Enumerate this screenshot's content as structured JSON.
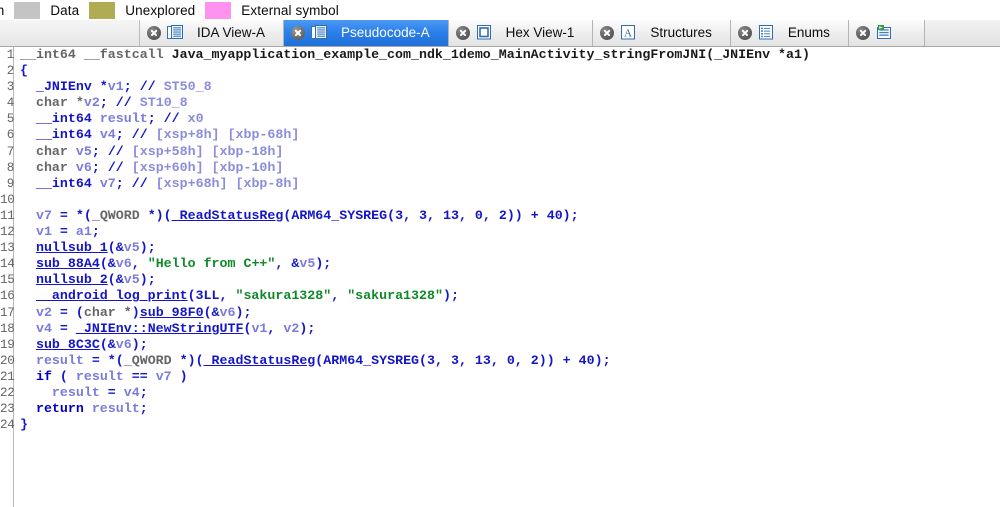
{
  "legend": {
    "items": [
      {
        "label": "ion",
        "swatch": null,
        "truncated": true
      },
      {
        "label": "Data",
        "swatch": "#c4c4c4"
      },
      {
        "label": "Unexplored",
        "swatch": "#b0ac54"
      },
      {
        "label": "External symbol",
        "swatch": "#ff92ef"
      }
    ]
  },
  "tabs": [
    {
      "label": "IDA View-A",
      "icon": "document-list-icon",
      "active": false,
      "closable": true
    },
    {
      "label": "Pseudocode-A",
      "icon": "document-list-icon",
      "active": true,
      "closable": true
    },
    {
      "label": "Hex View-1",
      "icon": "hex-square-icon",
      "active": false,
      "closable": true
    },
    {
      "label": "Structures",
      "icon": "letter-a-icon",
      "active": false,
      "closable": true
    },
    {
      "label": "Enums",
      "icon": "enum-list-icon",
      "active": false,
      "closable": true
    },
    {
      "label": "",
      "icon": "imports-icon",
      "active": false,
      "closable": true
    }
  ],
  "colors": {
    "active_tab": "#2b7fe8",
    "string": "#0f8a2a",
    "comment": "#8c8cdc",
    "variable": "#7b7bdc",
    "function": "#1414c8",
    "type": "#666666",
    "line_number": "#646464"
  },
  "code": {
    "language": "pseudocode-c",
    "first_line_number": 1,
    "lines": [
      {
        "n": "1",
        "tokens": [
          {
            "t": "type",
            "v": "__int64 __fastcall "
          },
          {
            "t": "plain",
            "v": "Java_myapplication_example_com_ndk_1demo_MainActivity_stringFromJNI(_JNIEnv *a1)"
          }
        ]
      },
      {
        "n": "2",
        "tokens": [
          {
            "t": "fn",
            "v": "{"
          }
        ]
      },
      {
        "n": "3",
        "tokens": [
          {
            "t": "plain",
            "v": "  "
          },
          {
            "t": "fn",
            "v": "_JNIEnv *"
          },
          {
            "t": "var",
            "v": "v1"
          },
          {
            "t": "fn",
            "v": "; "
          },
          {
            "t": "fn",
            "v": "// "
          },
          {
            "t": "cmt",
            "v": "ST50_8"
          }
        ]
      },
      {
        "n": "4",
        "tokens": [
          {
            "t": "plain",
            "v": "  "
          },
          {
            "t": "type",
            "v": "char *"
          },
          {
            "t": "var",
            "v": "v2"
          },
          {
            "t": "fn",
            "v": "; "
          },
          {
            "t": "fn",
            "v": "// "
          },
          {
            "t": "cmt",
            "v": "ST10_8"
          }
        ]
      },
      {
        "n": "5",
        "tokens": [
          {
            "t": "plain",
            "v": "  "
          },
          {
            "t": "fn",
            "v": "__int64 "
          },
          {
            "t": "var",
            "v": "result"
          },
          {
            "t": "fn",
            "v": "; "
          },
          {
            "t": "fn",
            "v": "// "
          },
          {
            "t": "cmt",
            "v": "x0"
          }
        ]
      },
      {
        "n": "6",
        "tokens": [
          {
            "t": "plain",
            "v": "  "
          },
          {
            "t": "fn",
            "v": "__int64 "
          },
          {
            "t": "var",
            "v": "v4"
          },
          {
            "t": "fn",
            "v": "; "
          },
          {
            "t": "fn",
            "v": "// "
          },
          {
            "t": "cmt",
            "v": "[xsp+8h] [xbp-68h]"
          }
        ]
      },
      {
        "n": "7",
        "tokens": [
          {
            "t": "plain",
            "v": "  "
          },
          {
            "t": "type",
            "v": "char "
          },
          {
            "t": "var",
            "v": "v5"
          },
          {
            "t": "fn",
            "v": "; "
          },
          {
            "t": "fn",
            "v": "// "
          },
          {
            "t": "cmt",
            "v": "[xsp+58h] [xbp-18h]"
          }
        ]
      },
      {
        "n": "8",
        "tokens": [
          {
            "t": "plain",
            "v": "  "
          },
          {
            "t": "type",
            "v": "char "
          },
          {
            "t": "var",
            "v": "v6"
          },
          {
            "t": "fn",
            "v": "; "
          },
          {
            "t": "fn",
            "v": "// "
          },
          {
            "t": "cmt",
            "v": "[xsp+60h] [xbp-10h]"
          }
        ]
      },
      {
        "n": "9",
        "tokens": [
          {
            "t": "plain",
            "v": "  "
          },
          {
            "t": "fn",
            "v": "__int64 "
          },
          {
            "t": "var",
            "v": "v7"
          },
          {
            "t": "fn",
            "v": "; "
          },
          {
            "t": "fn",
            "v": "// "
          },
          {
            "t": "cmt",
            "v": "[xsp+68h] [xbp-8h]"
          }
        ]
      },
      {
        "n": "10",
        "tokens": []
      },
      {
        "n": "11",
        "tokens": [
          {
            "t": "plain",
            "v": "  "
          },
          {
            "t": "var",
            "v": "v7"
          },
          {
            "t": "fn",
            "v": " = *("
          },
          {
            "t": "type",
            "v": "_QWORD "
          },
          {
            "t": "fn",
            "v": "*)("
          },
          {
            "t": "fnlink",
            "v": "_ReadStatusReg"
          },
          {
            "t": "fn",
            "v": "("
          },
          {
            "t": "fn",
            "v": "ARM64_SYSREG"
          },
          {
            "t": "fn",
            "v": "(3, 3, 13, 0, 2)) + 40);"
          }
        ]
      },
      {
        "n": "12",
        "tokens": [
          {
            "t": "plain",
            "v": "  "
          },
          {
            "t": "var",
            "v": "v1"
          },
          {
            "t": "fn",
            "v": " = "
          },
          {
            "t": "var",
            "v": "a1"
          },
          {
            "t": "fn",
            "v": ";"
          }
        ]
      },
      {
        "n": "13",
        "tokens": [
          {
            "t": "plain",
            "v": "  "
          },
          {
            "t": "fnlink",
            "v": "nullsub_1"
          },
          {
            "t": "fn",
            "v": "(&"
          },
          {
            "t": "var",
            "v": "v5"
          },
          {
            "t": "fn",
            "v": ");"
          }
        ]
      },
      {
        "n": "14",
        "tokens": [
          {
            "t": "plain",
            "v": "  "
          },
          {
            "t": "fnlink",
            "v": "sub_88A4"
          },
          {
            "t": "fn",
            "v": "(&"
          },
          {
            "t": "var",
            "v": "v6"
          },
          {
            "t": "fn",
            "v": ", "
          },
          {
            "t": "str",
            "v": "\"Hello from C++\""
          },
          {
            "t": "fn",
            "v": ", &"
          },
          {
            "t": "var",
            "v": "v5"
          },
          {
            "t": "fn",
            "v": ");"
          }
        ]
      },
      {
        "n": "15",
        "tokens": [
          {
            "t": "plain",
            "v": "  "
          },
          {
            "t": "fnlink",
            "v": "nullsub_2"
          },
          {
            "t": "fn",
            "v": "(&"
          },
          {
            "t": "var",
            "v": "v5"
          },
          {
            "t": "fn",
            "v": ");"
          }
        ]
      },
      {
        "n": "16",
        "tokens": [
          {
            "t": "plain",
            "v": "  "
          },
          {
            "t": "fnlink",
            "v": "__android_log_print"
          },
          {
            "t": "fn",
            "v": "(3LL, "
          },
          {
            "t": "str",
            "v": "\"sakura1328\""
          },
          {
            "t": "fn",
            "v": ", "
          },
          {
            "t": "str",
            "v": "\"sakura1328\""
          },
          {
            "t": "fn",
            "v": ");"
          }
        ]
      },
      {
        "n": "17",
        "tokens": [
          {
            "t": "plain",
            "v": "  "
          },
          {
            "t": "var",
            "v": "v2"
          },
          {
            "t": "fn",
            "v": " = ("
          },
          {
            "t": "type",
            "v": "char *"
          },
          {
            "t": "fn",
            "v": ")"
          },
          {
            "t": "fnlink",
            "v": "sub_98F0"
          },
          {
            "t": "fn",
            "v": "(&"
          },
          {
            "t": "var",
            "v": "v6"
          },
          {
            "t": "fn",
            "v": ");"
          }
        ]
      },
      {
        "n": "18",
        "tokens": [
          {
            "t": "plain",
            "v": "  "
          },
          {
            "t": "var",
            "v": "v4"
          },
          {
            "t": "fn",
            "v": " = "
          },
          {
            "t": "fnlink",
            "v": "_JNIEnv::NewStringUTF"
          },
          {
            "t": "fn",
            "v": "("
          },
          {
            "t": "var",
            "v": "v1"
          },
          {
            "t": "fn",
            "v": ", "
          },
          {
            "t": "var",
            "v": "v2"
          },
          {
            "t": "fn",
            "v": ");"
          }
        ]
      },
      {
        "n": "19",
        "tokens": [
          {
            "t": "plain",
            "v": "  "
          },
          {
            "t": "fnlink",
            "v": "sub_8C3C"
          },
          {
            "t": "fn",
            "v": "(&"
          },
          {
            "t": "var",
            "v": "v6"
          },
          {
            "t": "fn",
            "v": ");"
          }
        ]
      },
      {
        "n": "20",
        "tokens": [
          {
            "t": "plain",
            "v": "  "
          },
          {
            "t": "var",
            "v": "result"
          },
          {
            "t": "fn",
            "v": " = *("
          },
          {
            "t": "type",
            "v": "_QWORD "
          },
          {
            "t": "fn",
            "v": "*)("
          },
          {
            "t": "fnlink",
            "v": "_ReadStatusReg"
          },
          {
            "t": "fn",
            "v": "("
          },
          {
            "t": "fn",
            "v": "ARM64_SYSREG"
          },
          {
            "t": "fn",
            "v": "(3, 3, 13, 0, 2)) + 40);"
          }
        ]
      },
      {
        "n": "21",
        "tokens": [
          {
            "t": "plain",
            "v": "  "
          },
          {
            "t": "kw",
            "v": "if"
          },
          {
            "t": "fn",
            "v": " ( "
          },
          {
            "t": "var",
            "v": "result"
          },
          {
            "t": "fn",
            "v": " == "
          },
          {
            "t": "var",
            "v": "v7"
          },
          {
            "t": "fn",
            "v": " )"
          }
        ]
      },
      {
        "n": "22",
        "tokens": [
          {
            "t": "plain",
            "v": "    "
          },
          {
            "t": "var",
            "v": "result"
          },
          {
            "t": "fn",
            "v": " = "
          },
          {
            "t": "var",
            "v": "v4"
          },
          {
            "t": "fn",
            "v": ";"
          }
        ]
      },
      {
        "n": "23",
        "tokens": [
          {
            "t": "plain",
            "v": "  "
          },
          {
            "t": "kw",
            "v": "return "
          },
          {
            "t": "var",
            "v": "result"
          },
          {
            "t": "fn",
            "v": ";"
          }
        ]
      },
      {
        "n": "24",
        "tokens": [
          {
            "t": "fn",
            "v": "}"
          }
        ]
      }
    ]
  }
}
